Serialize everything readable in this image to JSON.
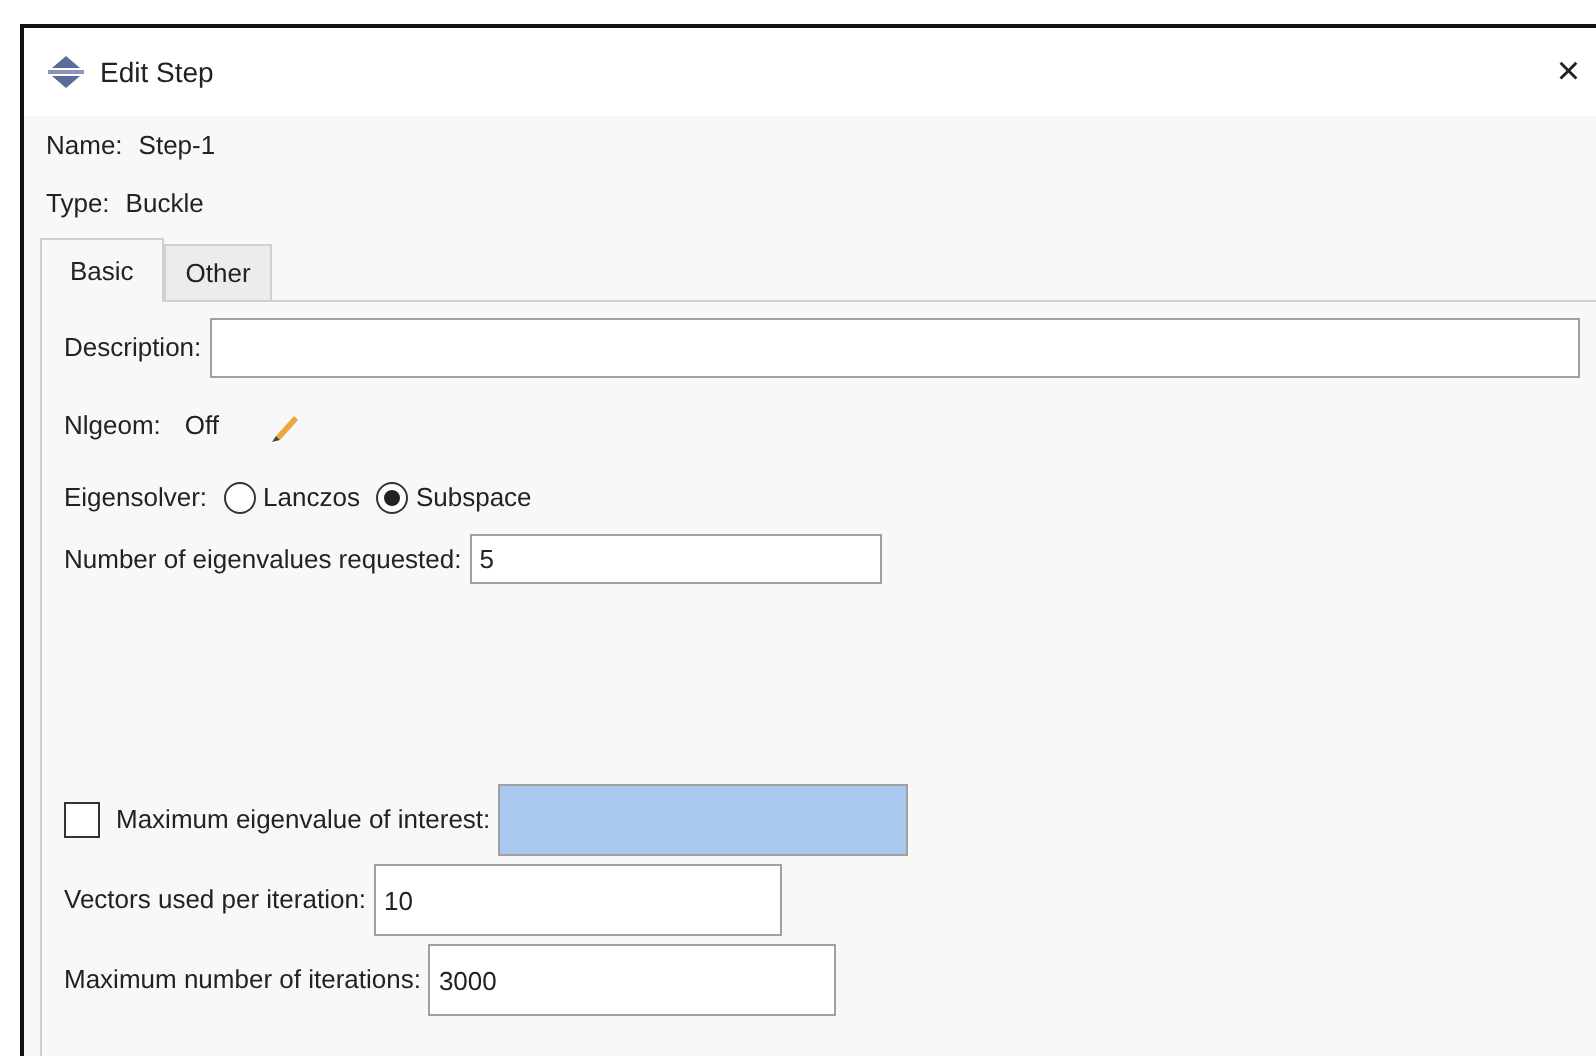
{
  "window": {
    "title": "Edit Step",
    "close": "×"
  },
  "name": {
    "label": "Name:",
    "value": "Step-1"
  },
  "type": {
    "label": "Type:",
    "value": "Buckle"
  },
  "tabs": [
    {
      "label": "Basic",
      "selected": true
    },
    {
      "label": "Other",
      "selected": false
    }
  ],
  "description": {
    "label": "Description:"
  },
  "nlgeom": {
    "label": "Nlgeom:",
    "value": "Off"
  },
  "eigensolver": {
    "label": "Eigensolver:",
    "options": [
      {
        "label": "Lanczos",
        "selected": false
      },
      {
        "label": "Subspace",
        "selected": true
      }
    ]
  },
  "eigenvalues_requested": {
    "label": "Number of eigenvalues requested:",
    "value": "5"
  },
  "max_eigenvalue": {
    "label": "Maximum eigenvalue of interest:",
    "checked": false
  },
  "vectors_per_iteration": {
    "label": "Vectors used per iteration:",
    "value": "10"
  },
  "max_iterations": {
    "label": "Maximum number of iterations:",
    "value": "3000"
  }
}
